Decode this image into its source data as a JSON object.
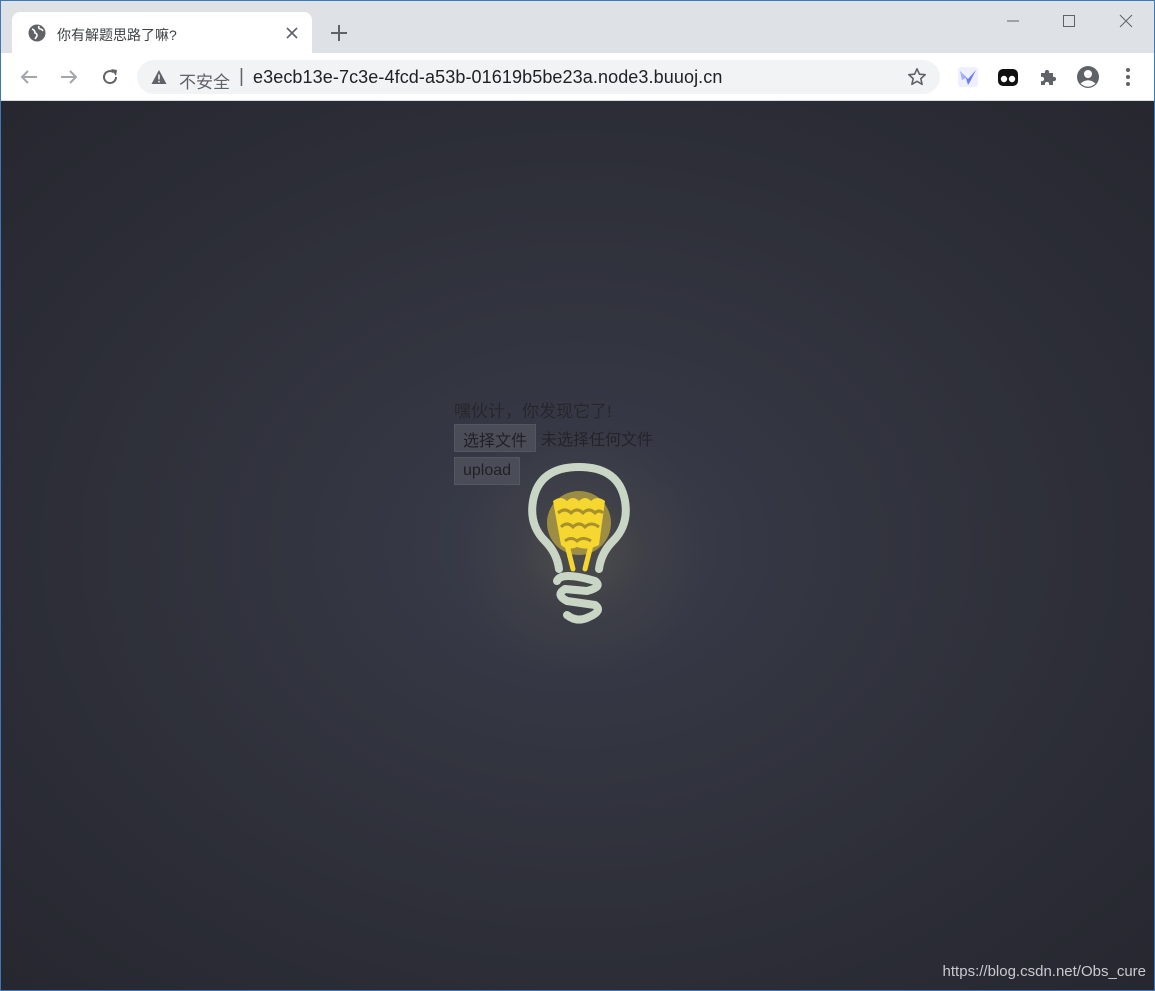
{
  "browser": {
    "tab": {
      "title": "你有解题思路了嘛?"
    },
    "address": {
      "security_label": "不安全",
      "separator": "|",
      "url": "e3ecb13e-7c3e-4fcd-a53b-01619b5be23a.node3.buuoj.cn"
    },
    "icons": [
      "globe-icon",
      "close-icon",
      "plus-icon",
      "minimize-icon",
      "maximize-icon",
      "close-window-icon",
      "back-icon",
      "forward-icon",
      "reload-icon",
      "warning-icon",
      "star-icon",
      "bird-extension-icon",
      "eyes-extension-icon",
      "puzzle-icon",
      "account-icon",
      "more-icon"
    ]
  },
  "page": {
    "hint": "嘿伙计，你发现它了!",
    "file_button": "选择文件",
    "no_file": "未选择任何文件",
    "upload_button": "upload",
    "watermark": "https://blog.csdn.net/Obs_cure"
  },
  "colors": {
    "bulb_outline": "#c9d6c6",
    "bulb_filament": "#f5d730",
    "bulb_glow": "#b9a542",
    "background": "#2f313c"
  }
}
